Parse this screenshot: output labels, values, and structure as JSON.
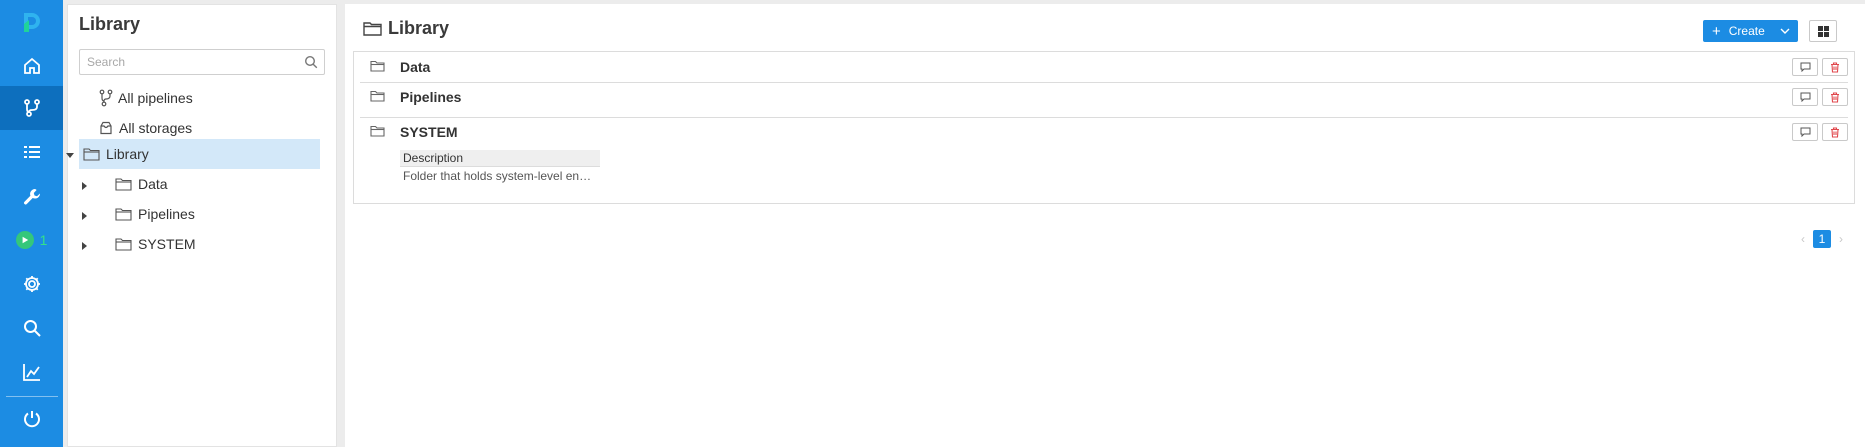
{
  "nav_rail": {
    "items": [
      {
        "icon": "home-icon"
      },
      {
        "icon": "pipelines-icon",
        "active": true
      },
      {
        "icon": "list-icon"
      },
      {
        "icon": "wrench-icon"
      },
      {
        "icon": "play-icon",
        "count": "1"
      },
      {
        "icon": "gear-icon"
      },
      {
        "icon": "search-icon"
      },
      {
        "icon": "chart-icon"
      },
      {
        "icon": "power-icon"
      }
    ]
  },
  "tree": {
    "title": "Library",
    "search_placeholder": "Search",
    "all_pipelines": "All pipelines",
    "all_storages": "All storages",
    "root": "Library",
    "children": [
      "Data",
      "Pipelines",
      "SYSTEM"
    ]
  },
  "main": {
    "title": "Library",
    "create_label": "Create",
    "rows": [
      {
        "name": "Data"
      },
      {
        "name": "Pipelines"
      },
      {
        "name": "SYSTEM",
        "description_header": "Description",
        "description": "Folder that holds system-level en…"
      }
    ],
    "page": "1",
    "prev_arrow": "‹",
    "next_arrow": "›"
  },
  "colors": {
    "rail": "#1c8ce3",
    "rail_active": "#0d6fbe",
    "selection": "#d3e8f9",
    "delete": "#e0474c",
    "run_badge": "#34c77b"
  }
}
